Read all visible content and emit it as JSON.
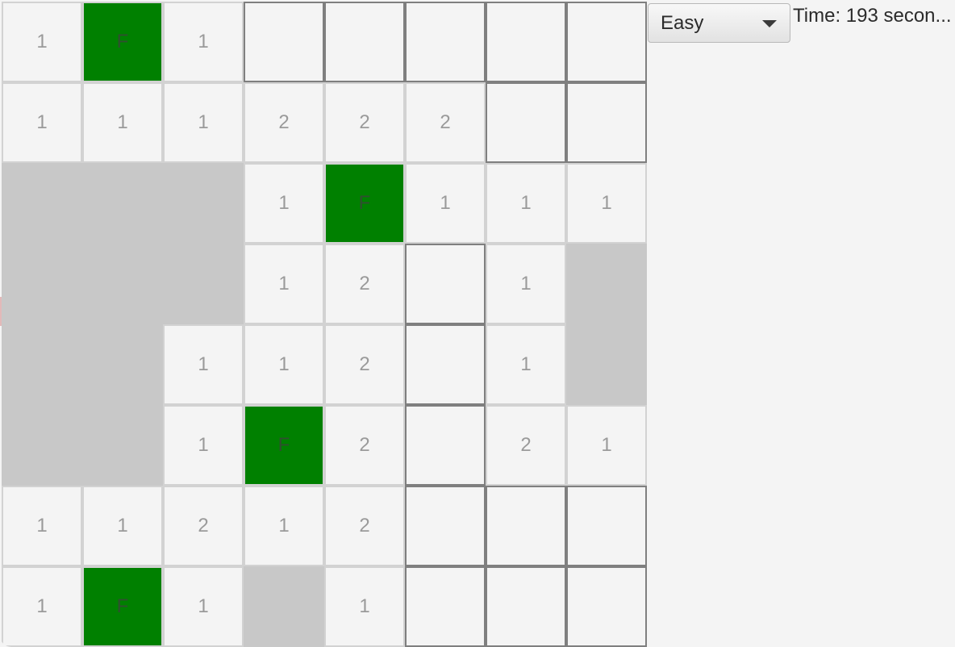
{
  "difficulty": {
    "selected": "Easy",
    "arrow_icon": "chevron-down-icon"
  },
  "timer": {
    "text": "Time: 193 secon..."
  },
  "board": {
    "rows": 8,
    "cols": 8,
    "flag_color": "#008000",
    "cells": [
      [
        {
          "s": "r",
          "t": "1"
        },
        {
          "s": "f",
          "t": "F"
        },
        {
          "s": "r",
          "t": "1"
        },
        {
          "s": "h",
          "t": ""
        },
        {
          "s": "h",
          "t": ""
        },
        {
          "s": "h",
          "t": ""
        },
        {
          "s": "h",
          "t": ""
        },
        {
          "s": "h",
          "t": ""
        }
      ],
      [
        {
          "s": "r",
          "t": "1"
        },
        {
          "s": "r",
          "t": "1"
        },
        {
          "s": "r",
          "t": "1"
        },
        {
          "s": "r",
          "t": "2"
        },
        {
          "s": "r",
          "t": "2"
        },
        {
          "s": "r",
          "t": "2"
        },
        {
          "s": "h",
          "t": ""
        },
        {
          "s": "h",
          "t": ""
        }
      ],
      [
        {
          "s": "b",
          "t": ""
        },
        {
          "s": "b",
          "t": ""
        },
        {
          "s": "b",
          "t": ""
        },
        {
          "s": "r",
          "t": "1"
        },
        {
          "s": "f",
          "t": "F"
        },
        {
          "s": "r",
          "t": "1"
        },
        {
          "s": "r",
          "t": "1"
        },
        {
          "s": "r",
          "t": "1"
        }
      ],
      [
        {
          "s": "b",
          "t": ""
        },
        {
          "s": "b",
          "t": ""
        },
        {
          "s": "b",
          "t": ""
        },
        {
          "s": "r",
          "t": "1"
        },
        {
          "s": "r",
          "t": "2"
        },
        {
          "s": "h",
          "t": ""
        },
        {
          "s": "r",
          "t": "1"
        },
        {
          "s": "b",
          "t": ""
        }
      ],
      [
        {
          "s": "b",
          "t": ""
        },
        {
          "s": "b",
          "t": ""
        },
        {
          "s": "r",
          "t": "1"
        },
        {
          "s": "r",
          "t": "1"
        },
        {
          "s": "r",
          "t": "2"
        },
        {
          "s": "h",
          "t": ""
        },
        {
          "s": "r",
          "t": "1"
        },
        {
          "s": "b",
          "t": ""
        }
      ],
      [
        {
          "s": "b",
          "t": ""
        },
        {
          "s": "b",
          "t": ""
        },
        {
          "s": "r",
          "t": "1"
        },
        {
          "s": "f",
          "t": "F"
        },
        {
          "s": "r",
          "t": "2"
        },
        {
          "s": "h",
          "t": ""
        },
        {
          "s": "r",
          "t": "2"
        },
        {
          "s": "r",
          "t": "1"
        }
      ],
      [
        {
          "s": "r",
          "t": "1"
        },
        {
          "s": "r",
          "t": "1"
        },
        {
          "s": "r",
          "t": "2"
        },
        {
          "s": "r",
          "t": "1"
        },
        {
          "s": "r",
          "t": "2"
        },
        {
          "s": "h",
          "t": ""
        },
        {
          "s": "h",
          "t": ""
        },
        {
          "s": "h",
          "t": ""
        }
      ],
      [
        {
          "s": "r",
          "t": "1"
        },
        {
          "s": "f",
          "t": "F"
        },
        {
          "s": "r",
          "t": "1"
        },
        {
          "s": "b",
          "t": ""
        },
        {
          "s": "r",
          "t": "1"
        },
        {
          "s": "h",
          "t": ""
        },
        {
          "s": "h",
          "t": ""
        },
        {
          "s": "h",
          "t": ""
        }
      ]
    ]
  }
}
